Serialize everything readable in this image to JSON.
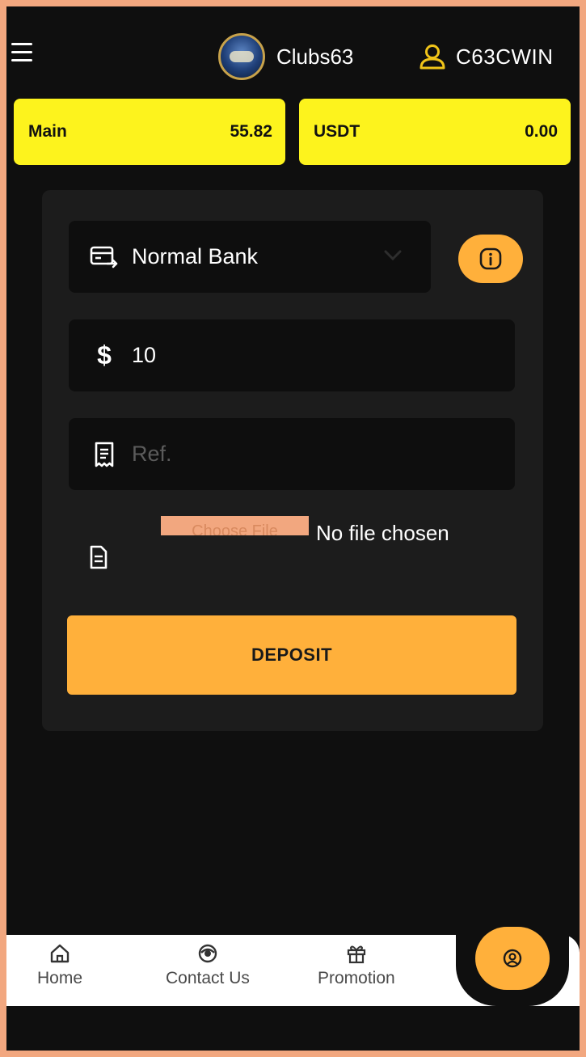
{
  "header": {
    "brand_name": "Clubs63",
    "username": "C63CWIN"
  },
  "balances": [
    {
      "label": "Main",
      "value": "55.82"
    },
    {
      "label": "USDT",
      "value": "0.00"
    }
  ],
  "deposit_form": {
    "method": "Normal Bank",
    "amount": "10",
    "amount_symbol": "$",
    "ref_placeholder": "Ref.",
    "ref_value": "",
    "choose_file_label": "Choose File",
    "file_status": "No file chosen",
    "submit_label": "DEPOSIT"
  },
  "bottom_nav": [
    {
      "label": "Home",
      "icon": "home-icon"
    },
    {
      "label": "Contact Us",
      "icon": "contact-icon"
    },
    {
      "label": "Promotion",
      "icon": "gift-icon"
    }
  ],
  "colors": {
    "accent": "#ffb03b",
    "balance_card": "#fdf31d",
    "background": "#0f0f0f",
    "user_icon": "#f0c419"
  }
}
